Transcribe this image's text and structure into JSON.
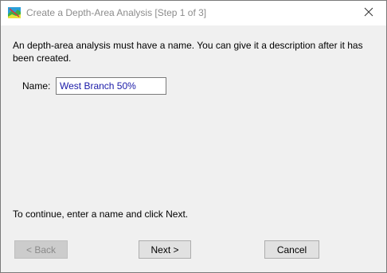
{
  "window": {
    "title": "Create a Depth-Area Analysis [Step 1 of 3]",
    "app_icon": "map-icon",
    "close_icon": "close-icon"
  },
  "content": {
    "description": "An depth-area analysis must have a name. You can give it a description after it has been created.",
    "name_label": "Name:",
    "name_value": "West Branch 50%",
    "hint": "To continue, enter a name and click Next."
  },
  "buttons": {
    "back_label": "< Back",
    "back_enabled": false,
    "next_label": "Next >",
    "cancel_label": "Cancel"
  },
  "colors": {
    "window_bg": "#f0f0f0",
    "title_text": "#8c8c8c",
    "input_text": "#1a1aa8",
    "disabled_button_bg": "#cccccc",
    "button_bg": "#e1e1e1"
  }
}
